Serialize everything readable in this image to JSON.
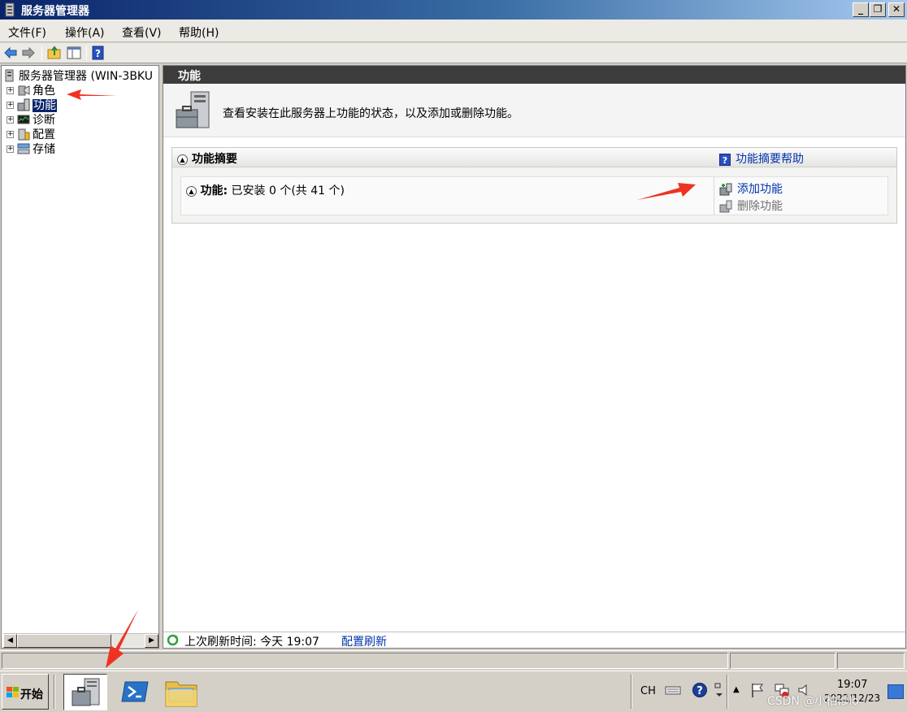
{
  "window": {
    "title": "服务器管理器",
    "icon": "server-manager-icon"
  },
  "menu": {
    "items": [
      "文件(F)",
      "操作(A)",
      "查看(V)",
      "帮助(H)"
    ]
  },
  "toolbar": {
    "buttons": [
      "back-arrow-icon",
      "forward-arrow-icon",
      "up-folder-icon",
      "show-hide-tree-icon",
      "help-icon"
    ]
  },
  "tree": {
    "root_label": "服务器管理器 (WIN-3BKU",
    "nodes": [
      {
        "label": "角色",
        "icon": "roles-icon",
        "expander": "+"
      },
      {
        "label": "功能",
        "icon": "features-icon",
        "expander": "+",
        "selected": true
      },
      {
        "label": "诊断",
        "icon": "diagnostics-icon",
        "expander": "+"
      },
      {
        "label": "配置",
        "icon": "configuration-icon",
        "expander": "+"
      },
      {
        "label": "存储",
        "icon": "storage-icon",
        "expander": "+"
      }
    ]
  },
  "content": {
    "header": "功能",
    "intro": "查看安装在此服务器上功能的状态，以及添加或删除功能。",
    "summary": {
      "title": "功能摘要",
      "help_link": "功能摘要帮助",
      "features_label": "功能:",
      "features_status": "已安装 0 个(共 41 个)",
      "actions": {
        "add": "添加功能",
        "remove": "删除功能"
      }
    },
    "refresh": {
      "text": "上次刷新时间: 今天 19:07",
      "link": "配置刷新"
    }
  },
  "taskbar": {
    "start_label": "开始",
    "apps": [
      "server-manager-taskbar-icon",
      "powershell-icon",
      "explorer-folder-icon"
    ],
    "lang": "CH",
    "clock_time": "19:07",
    "clock_date": "2022/12/23",
    "watermark": "CSDN @小柏ぱlo"
  },
  "colors": {
    "title_bar_start": "#0a246a",
    "title_bar_end": "#a6caf0",
    "content_header_bg": "#3c3c3c",
    "link": "#0033aa",
    "selection": "#0a246a",
    "annotation_arrow": "#ee3322"
  }
}
